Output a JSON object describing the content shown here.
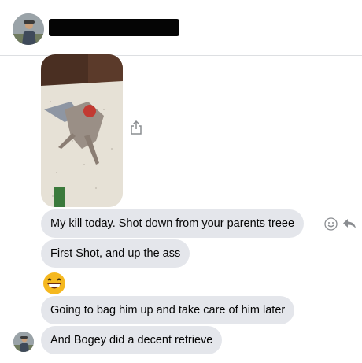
{
  "conversation": {
    "contact_avatar_icon": "user-avatar-icon",
    "messages": [
      {
        "type": "image",
        "description_icon": "photo-icon"
      },
      {
        "type": "text",
        "text": "My kill today. Shot down from your parents treee"
      },
      {
        "type": "text",
        "text": "First Shot, and up the ass"
      },
      {
        "type": "emoji",
        "icon": "grinning-face-icon"
      },
      {
        "type": "text",
        "text": "Going to bag him up and take care of him later"
      },
      {
        "type": "text",
        "text": "And Bogey did a decent retrieve"
      }
    ],
    "actions": {
      "react_icon": "smiley-icon",
      "reply_icon": "reply-icon",
      "share_icon": "share-icon"
    }
  },
  "colors": {
    "bubble": "#e4e6eb",
    "text": "#050505",
    "divider": "#dddfe2",
    "icon": "#8a8d91"
  }
}
